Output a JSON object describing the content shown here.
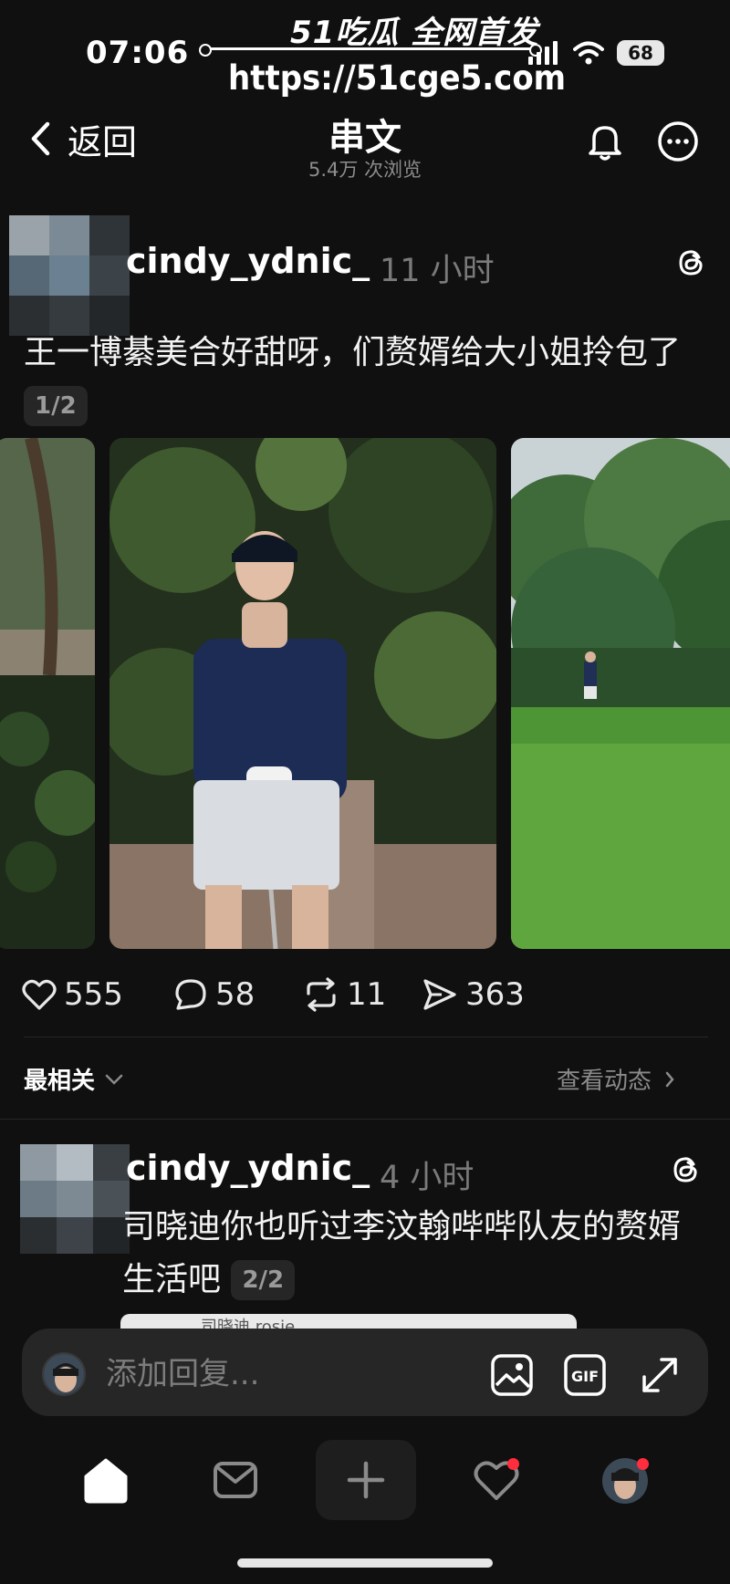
{
  "status_bar": {
    "time": "07:06",
    "battery": "68"
  },
  "watermark": {
    "title": "51吃瓜 全网首发",
    "url": "https://51cge5.com"
  },
  "header": {
    "back_label": "返回",
    "title": "串文",
    "views": "5.4万 次浏览"
  },
  "post": {
    "username": "cindy_ydnic_",
    "time_ago": "11 小时",
    "text": "王一博綦美合好甜呀，们赘婿给大小姐拎包了",
    "page_indicator": "1/2",
    "stats": {
      "likes": "555",
      "comments": "58",
      "reposts": "11",
      "shares": "363"
    }
  },
  "replies_bar": {
    "sort_label": "最相关",
    "activity_label": "查看动态"
  },
  "reply": {
    "username": "cindy_ydnic_",
    "time_ago": "4 小时",
    "text": "司晓迪你也听过李汶翰哔哔队友的赘婿生活吧",
    "page_indicator": "2/2",
    "quote_preview": "司晓迪 rosie"
  },
  "composer": {
    "placeholder": "添加回复..."
  },
  "icons": {
    "back": "chevron-left-icon",
    "bell": "bell-icon",
    "more": "more-horizontal-icon",
    "threads": "threads-icon",
    "heart": "heart-icon",
    "comment": "comment-icon",
    "repost": "repost-icon",
    "share": "share-icon",
    "image": "image-icon",
    "gif": "gif-icon",
    "expand": "expand-icon",
    "home": "home-icon",
    "inbox": "inbox-icon",
    "create": "plus-icon",
    "activity": "heart-icon",
    "profile": "avatar"
  },
  "colors": {
    "background": "#101010",
    "text_primary": "#f3f5f7",
    "text_secondary": "#8d8d8d",
    "notification_dot": "#ff2d3d"
  }
}
